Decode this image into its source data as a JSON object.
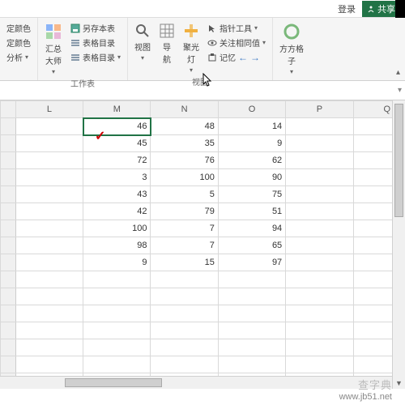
{
  "topbar": {
    "login": "登录",
    "share": "共享"
  },
  "ribbon": {
    "group1": {
      "items": [
        "定颜色",
        "定颜色",
        "分析"
      ],
      "dd": "▾"
    },
    "group2": {
      "big": "汇总\n大师",
      "col": [
        "另存本表",
        "表格目录",
        "表格目录"
      ],
      "dd": "▾",
      "label": "工作表"
    },
    "group3": {
      "btns": [
        "视图",
        "导\n航",
        "聚光\n灯"
      ],
      "col": [
        "指针工具",
        "关注相同值",
        "记忆"
      ],
      "dd": "▾",
      "label": "视图",
      "arrows": [
        "←",
        "→"
      ]
    },
    "group4": {
      "big": "方方格\n子",
      "dd": "▾"
    },
    "collapse": "▴"
  },
  "formula": {
    "expand": "▾"
  },
  "sheet": {
    "cols": [
      "L",
      "M",
      "N",
      "O",
      "P",
      "Q"
    ],
    "active": "M1",
    "rows": [
      {
        "M": 46,
        "N": 48,
        "O": 14
      },
      {
        "M": 45,
        "N": 35,
        "O": 9
      },
      {
        "M": 72,
        "N": 76,
        "O": 62
      },
      {
        "M": 3,
        "N": 100,
        "O": 90
      },
      {
        "M": 43,
        "N": 5,
        "O": 75
      },
      {
        "M": 42,
        "N": 79,
        "O": 51
      },
      {
        "M": 100,
        "N": 7,
        "O": 94
      },
      {
        "M": 98,
        "N": 7,
        "O": 65
      },
      {
        "M": 9,
        "N": 15,
        "O": 97
      }
    ],
    "empty_rows": 7
  },
  "footer": {
    "watermark": "查字典",
    "site": "www.jb51.net"
  },
  "checkmark": "✓"
}
